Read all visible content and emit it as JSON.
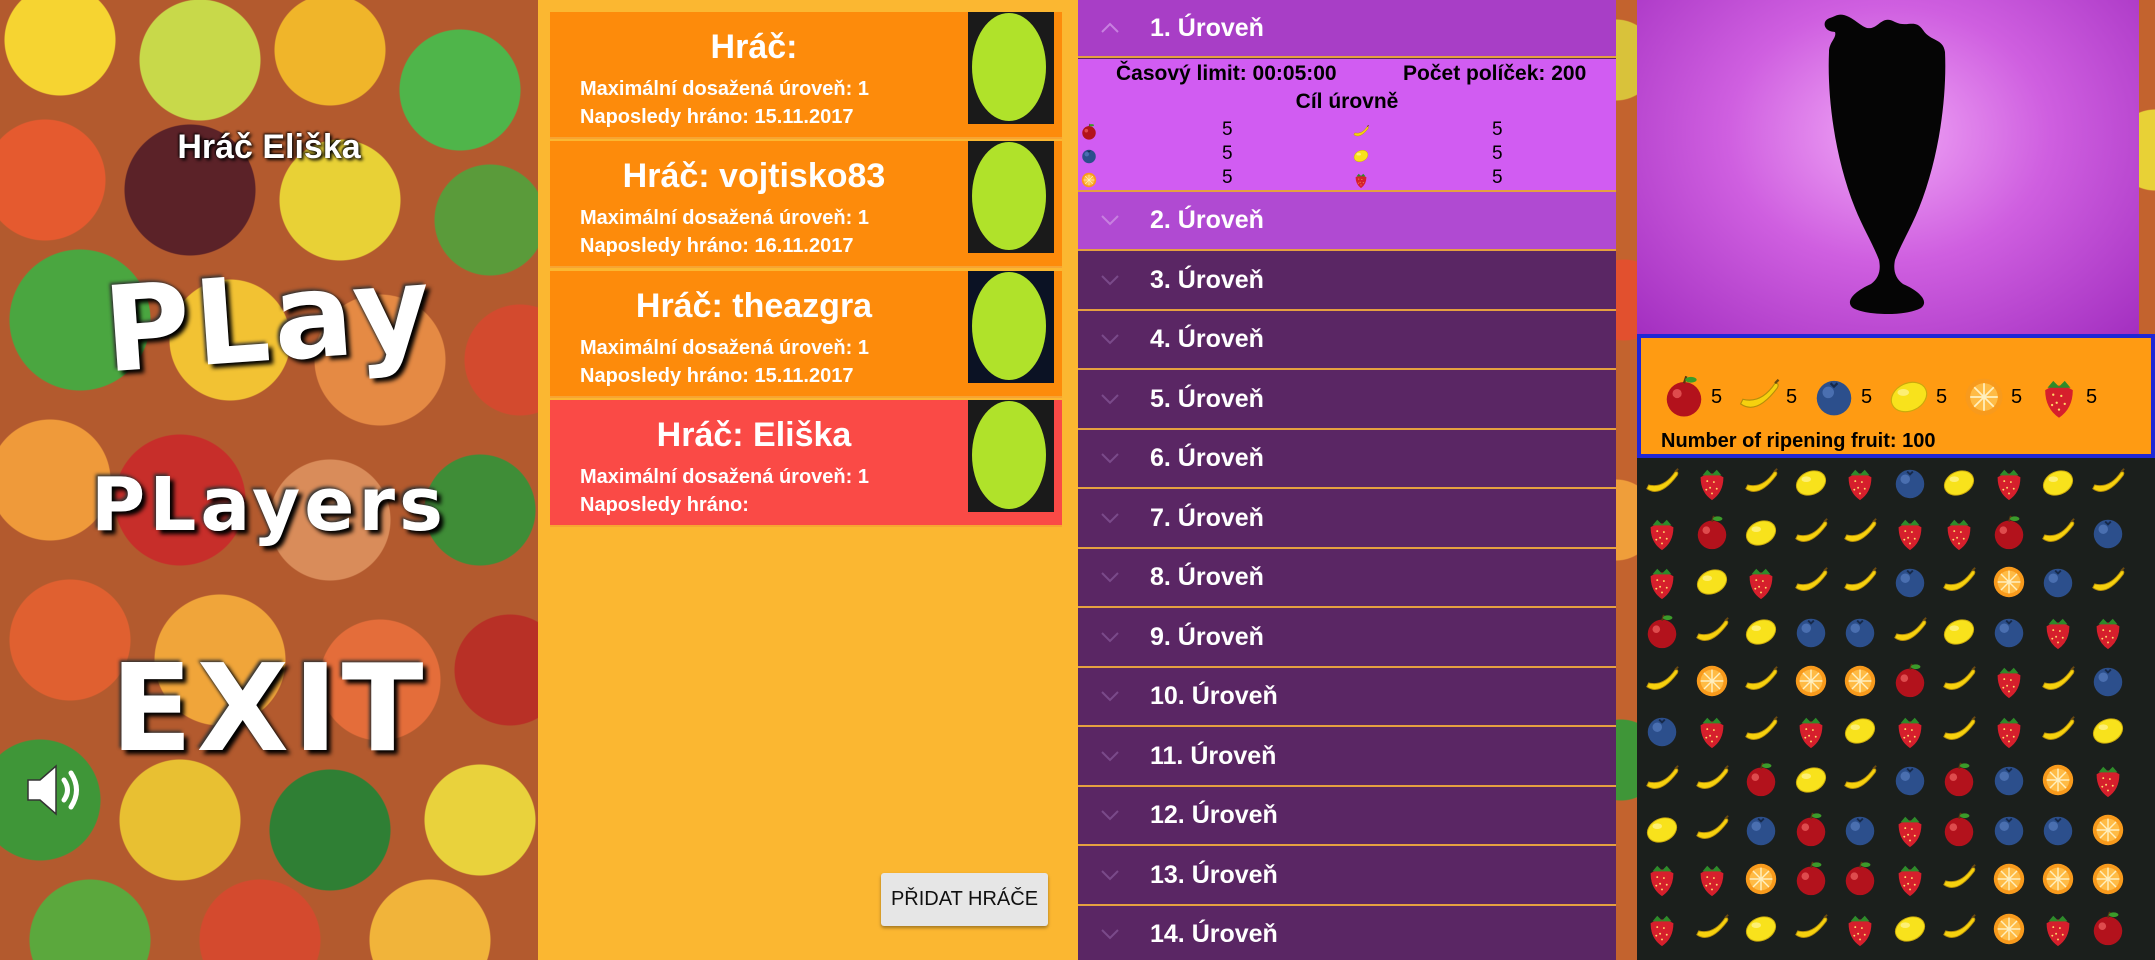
{
  "menu": {
    "player_name": "Hráč Eliška",
    "play_label": "PLay",
    "players_label": "PLayers",
    "exit_label": "EXIT",
    "sound_icon": "speaker-icon"
  },
  "players": {
    "cards": [
      {
        "title": "Hráč:",
        "max_level": "Maximální dosažená úroveň: 1",
        "last_played": "Naposledy hráno: 15.11.2017",
        "active": false
      },
      {
        "title": "Hráč: vojtisko83",
        "max_level": "Maximální dosažená úroveň: 1",
        "last_played": "Naposledy hráno: 16.11.2017",
        "active": false
      },
      {
        "title": "Hráč: theazgra",
        "max_level": "Maximální dosažená úroveň: 1",
        "last_played": "Naposledy hráno: 15.11.2017",
        "active": false
      },
      {
        "title": "Hráč: Eliška",
        "max_level": "Maximální dosažená úroveň: 1",
        "last_played": "Naposledy hráno:",
        "active": true
      }
    ],
    "add_button": "PŘIDAT HRÁČE"
  },
  "levels": {
    "items": [
      "1. Úroveň",
      "2. Úroveň",
      "3. Úroveň",
      "4. Úroveň",
      "5. Úroveň",
      "6. Úroveň",
      "7. Úroveň",
      "8. Úroveň",
      "9. Úroveň",
      "10. Úroveň",
      "11. Úroveň",
      "12. Úroveň",
      "13. Úroveň",
      "14. Úroveň"
    ],
    "expanded": {
      "time_limit": "Časový limit: 00:05:00",
      "cell_count": "Počet políček: 200",
      "goal_title": "Cíl úrovně",
      "goals": [
        {
          "fruit": "apple",
          "count": "5"
        },
        {
          "fruit": "banana",
          "count": "5"
        },
        {
          "fruit": "blueberry",
          "count": "5"
        },
        {
          "fruit": "lemon",
          "count": "5"
        },
        {
          "fruit": "orange",
          "count": "5"
        },
        {
          "fruit": "strawberry",
          "count": "5"
        }
      ]
    }
  },
  "game": {
    "goals": [
      {
        "fruit": "apple",
        "count": "5"
      },
      {
        "fruit": "banana",
        "count": "5"
      },
      {
        "fruit": "blueberry",
        "count": "5"
      },
      {
        "fruit": "lemon",
        "count": "5"
      },
      {
        "fruit": "orange",
        "count": "5"
      },
      {
        "fruit": "strawberry",
        "count": "5"
      }
    ],
    "ripening_text": "Number of ripening fruit: 100",
    "board": [
      [
        "banana",
        "strawberry",
        "banana",
        "lemon",
        "strawberry",
        "blueberry",
        "lemon",
        "strawberry",
        "lemon",
        "banana"
      ],
      [
        "strawberry",
        "apple",
        "lemon",
        "banana",
        "banana",
        "strawberry",
        "strawberry",
        "apple",
        "banana",
        "blueberry"
      ],
      [
        "strawberry",
        "lemon",
        "strawberry",
        "banana",
        "banana",
        "blueberry",
        "banana",
        "orange",
        "blueberry",
        "banana"
      ],
      [
        "apple",
        "banana",
        "lemon",
        "blueberry",
        "blueberry",
        "banana",
        "lemon",
        "blueberry",
        "strawberry",
        "strawberry"
      ],
      [
        "banana",
        "orange",
        "banana",
        "orange",
        "orange",
        "apple",
        "banana",
        "strawberry",
        "banana",
        "blueberry"
      ],
      [
        "blueberry",
        "strawberry",
        "banana",
        "strawberry",
        "lemon",
        "strawberry",
        "banana",
        "strawberry",
        "banana",
        "lemon"
      ],
      [
        "banana",
        "banana",
        "apple",
        "lemon",
        "banana",
        "blueberry",
        "apple",
        "blueberry",
        "orange",
        "strawberry"
      ],
      [
        "lemon",
        "banana",
        "blueberry",
        "apple",
        "blueberry",
        "strawberry",
        "apple",
        "blueberry",
        "blueberry",
        "orange"
      ],
      [
        "strawberry",
        "strawberry",
        "orange",
        "apple",
        "apple",
        "strawberry",
        "banana",
        "orange",
        "orange",
        "orange"
      ],
      [
        "strawberry",
        "banana",
        "lemon",
        "banana",
        "strawberry",
        "lemon",
        "banana",
        "orange",
        "strawberry",
        "apple"
      ]
    ],
    "colors": {
      "panel": "#ff9b12",
      "panel_border": "#1f27d6",
      "board": "#1b1f1c"
    }
  }
}
